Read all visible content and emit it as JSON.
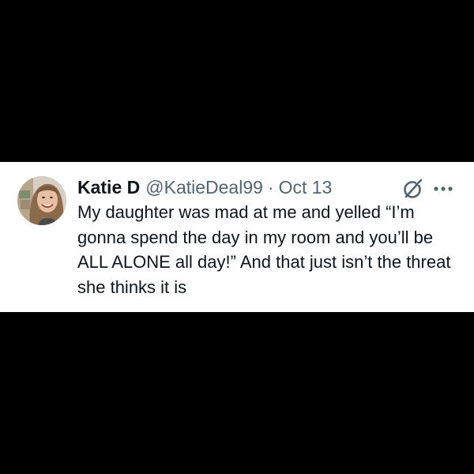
{
  "tweet": {
    "display_name": "Katie D",
    "handle": "@KatieDeal99",
    "separator": "·",
    "date": "Oct 13",
    "text": "My daughter was mad at me and yelled “I’m gonna spend the day in my room and you’ll be ALL ALONE all day!” And that just isn’t the threat she thinks it is"
  },
  "icons": {
    "avatar": "profile-photo",
    "grok": "grok-icon",
    "more": "more-horizontal-icon"
  },
  "colors": {
    "background": "#000000",
    "card": "#ffffff",
    "primary_text": "#0f1419",
    "secondary_text": "#536471"
  }
}
